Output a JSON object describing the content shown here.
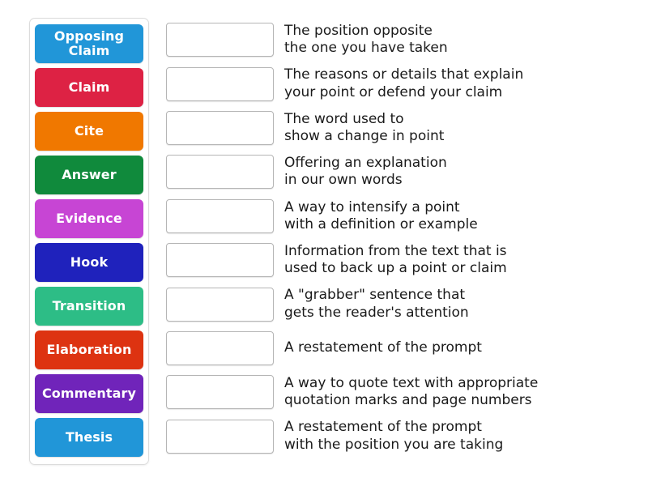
{
  "activity": {
    "type": "match-up",
    "tiles_panel_label": "draggable term tiles",
    "tiles": [
      {
        "label": "Opposing\nClaim",
        "color": "#2196d8",
        "text_color": "#ffffff"
      },
      {
        "label": "Claim",
        "color": "#dd2244",
        "text_color": "#ffffff"
      },
      {
        "label": "Cite",
        "color": "#f07800",
        "text_color": "#ffffff"
      },
      {
        "label": "Answer",
        "color": "#108a3c",
        "text_color": "#ffffff"
      },
      {
        "label": "Evidence",
        "color": "#c745d4",
        "text_color": "#ffffff"
      },
      {
        "label": "Hook",
        "color": "#1f22bc",
        "text_color": "#ffffff"
      },
      {
        "label": "Transition",
        "color": "#2dbd86",
        "text_color": "#ffffff"
      },
      {
        "label": "Elaboration",
        "color": "#dd3311",
        "text_color": "#ffffff"
      },
      {
        "label": "Commentary",
        "color": "#7024ba",
        "text_color": "#ffffff"
      },
      {
        "label": "Thesis",
        "color": "#2196d8",
        "text_color": "#ffffff"
      }
    ],
    "rows": [
      {
        "answer": "",
        "definition": "The position opposite\nthe one you have taken"
      },
      {
        "answer": "",
        "definition": "The reasons or details that explain\nyour point or defend your claim"
      },
      {
        "answer": "",
        "definition": "The word used to\nshow a change in point"
      },
      {
        "answer": "",
        "definition": "Offering an explanation\nin our own words"
      },
      {
        "answer": "",
        "definition": "A way to intensify a point\nwith a definition or example"
      },
      {
        "answer": "",
        "definition": "Information from the text that is\nused to back up a point or claim"
      },
      {
        "answer": "",
        "definition": "A \"grabber\" sentence that\ngets the reader's attention"
      },
      {
        "answer": "",
        "definition": "A restatement of the prompt"
      },
      {
        "answer": "",
        "definition": "A way to quote text with appropriate\nquotation marks and page numbers"
      },
      {
        "answer": "",
        "definition": "A restatement of the prompt\nwith the position you are taking"
      }
    ]
  }
}
